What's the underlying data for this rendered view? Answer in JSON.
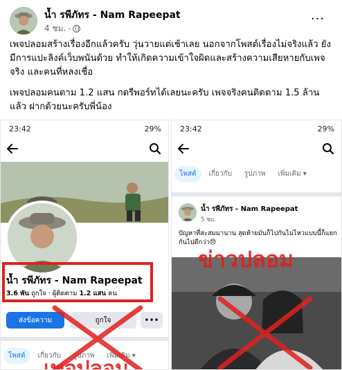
{
  "post": {
    "author": "น้ำ รพีภัทร - Nam Rapeepat",
    "time": "4 ชม.",
    "meta_dot": "·",
    "more_label": "···",
    "paragraph1": "เพจปลอมสร้างเรื่องอีกแล้วครับ วุ่นวายแต่เช้าเลย นอกจากโพสต์เรื่องไม่จริงแล้ว ยังมีการแปะลิงค์เว็บพนันด้วย ทำให้เกิดความเข้าใจผิดและสร้างความเสียหายกับเพจจริง และคนที่หลงเชื่อ",
    "paragraph2": "เพจปลอมคนตาม 1.2 แสน กดรีพอร์ทได้เลยนะครับ เพจจริงคนติดตาม 1.5 ล้าน แล้ว ฝากด้วยนะครับพี่น้อง"
  },
  "left_shot": {
    "status_time": "23:42",
    "status_battery": "29%",
    "page_name": "น้ำ รพีภัทร - Nam Rapeepat",
    "likes_count": "3.6 พัน",
    "likes_label": "ถูกใจ",
    "followers_label": "ผู้ติดตาม",
    "followers_count": "1.2 แสน",
    "followers_unit": "คน",
    "message_button": "ส่งข้อความ",
    "like_button": "ถูกใจ",
    "more_button": "•••",
    "tabs": [
      "โพสต์",
      "เกี่ยวกับ",
      "รูปภาพ",
      "เพิ่มเติม ▾"
    ],
    "stamp_text": "เพจปลอม"
  },
  "right_shot": {
    "status_time": "23:42",
    "status_battery": "29%",
    "tabs": [
      "โพสต์",
      "เกี่ยวกับ",
      "รูปภาพ",
      "เพิ่มเติม ▾"
    ],
    "post_author": "น้ำ รพีภัทร - Nam Rapeepat",
    "post_time": "5 ชม.",
    "post_text": "ปัญหาที่สะสมมานาน สุดท้ายมันก็ไปกันไม่ไหวแบบนี้ก็แยกกันไปดีกว่า😞",
    "stamp_text": "ข่าวปลอม"
  },
  "colors": {
    "accent": "#1b74e4",
    "warning_red": "#e02020",
    "muted": "#65676b"
  }
}
